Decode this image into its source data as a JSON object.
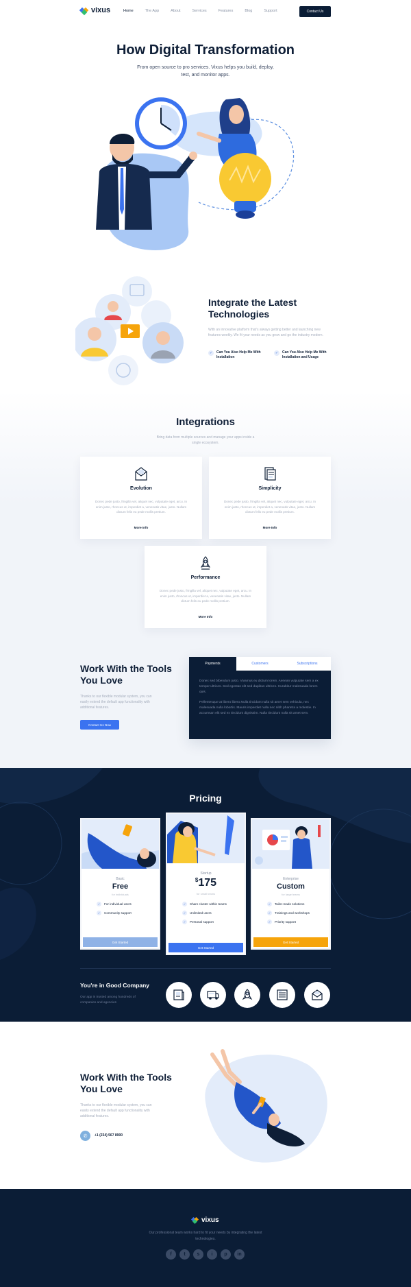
{
  "nav": {
    "logo": "vixus",
    "items": [
      "Home",
      "The App",
      "About",
      "Services",
      "Features",
      "Blog",
      "Support"
    ],
    "active": "Home",
    "contact_button": "Contact Us"
  },
  "hero": {
    "title": "How Digital Transformation",
    "subtitle": "From open source to pro services. Vixus helps you build, deploy, test, and monitor apps."
  },
  "integrate": {
    "title": "Integrate the Latest Technologies",
    "text": "With an innovative platform that's always getting better and launching new features weekly. We fit your needs as you grow and go the industry modern.",
    "checks": [
      "Can You Also Help Me With Installation",
      "Can You Also Help Me With Installation and Usage"
    ]
  },
  "integrations": {
    "title": "Integrations",
    "subtitle": "Bring data from multiple sources and manage your apps inside a single ecosystem.",
    "cards": [
      {
        "title": "Evolution",
        "text": "Donec pede justo, fringilla vel, aliquet nec, vulputate eget, arcu. In enim justo, rhoncus ut, imperdiet a, venenatis vitae, justo. Nullam dictum felis eu pede mollis pretium.",
        "more": "More Info",
        "icon": "envelope-icon"
      },
      {
        "title": "Simplicity",
        "text": "Donec pede justo, fringilla vel, aliquet nec, vulputate eget, arcu. In enim justo, rhoncus ut, imperdiet a, venenatis vitae, justo. Nullam dictum felis eu pede mollis pretium.",
        "more": "More Info",
        "icon": "document-icon"
      },
      {
        "title": "Performance",
        "text": "Donec pede justo, fringilla vel, aliquet nec, vulputate eget, arcu. In enim justo, rhoncus ut, imperdiet a, venenatis vitae, justo. Nullam dictum felis eu pede mollis pretium.",
        "more": "More Info",
        "icon": "rocket-icon"
      }
    ]
  },
  "tools": {
    "title": "Work With the Tools You Love",
    "text": "Thanks to our flexible modular system, you can easily extend the default app functionality with additional features.",
    "button": "Contact Us Now",
    "tabs": [
      "Payments",
      "Customers",
      "Subscriptions"
    ],
    "active_tab": "Payments",
    "panel": [
      "Donec sed bibendum justo. Vivamus eu dictum lorem. Aenean vulputate sem a ex tempor ultrices. Sed egestas elit sed dapibus ultrices. Curabitur malesuada lorem quis.",
      "Pellentesque at libero libero.Nulla tincidunt nulla sit amet sem vehicula, nec malesuada nulla lobortis. Mauris imperdiet nulla nec nibh pharetra a molestie. In accumsan elit sed ex tincidunt dignissim. Nulla tincidunt nulla sit amet sem."
    ]
  },
  "pricing": {
    "title": "Pricing",
    "plans": [
      {
        "tier": "Basic",
        "price": "Free",
        "for": "for individuals",
        "features": [
          "For individual users",
          "Community support"
        ],
        "button": "Get Started",
        "button_color": "#8fb2e6"
      },
      {
        "tier": "Startup",
        "currency": "$",
        "price": "175",
        "for": "for small teams",
        "features": [
          "Share cluster within teams",
          "Unlimited users",
          "Personal support"
        ],
        "button": "Get Started",
        "button_color": "#3b73f0"
      },
      {
        "tier": "Enterprise",
        "price": "Custom",
        "for": "for large teams",
        "features": [
          "Tailor-made solutions",
          "Trainings and workshops",
          "Priority support"
        ],
        "button": "Get Started",
        "button_color": "#f6a40b"
      }
    ],
    "good_title": "You're in Good Company",
    "good_text": "Our app is trusted among hundreds of companies and agencies",
    "badges": [
      "newspaper-icon",
      "truck-icon",
      "rocket-icon",
      "server-icon",
      "envelope-icon"
    ]
  },
  "work2": {
    "title": "Work With the Tools You Love",
    "text": "Thanks to our flexible modular system, you can easily extend the default app functionality with additional features.",
    "phone": "+1 (234) 567 8900"
  },
  "footer": {
    "logo": "vixus",
    "text": "Our professional team works hard to fit your needs by integrating the latest technologies.",
    "socials": [
      "f",
      "t",
      "s",
      "i",
      "p",
      "in"
    ]
  },
  "colors": {
    "navy": "#0b1d36",
    "accent": "#3b73f0",
    "orange": "#f6a40b"
  }
}
